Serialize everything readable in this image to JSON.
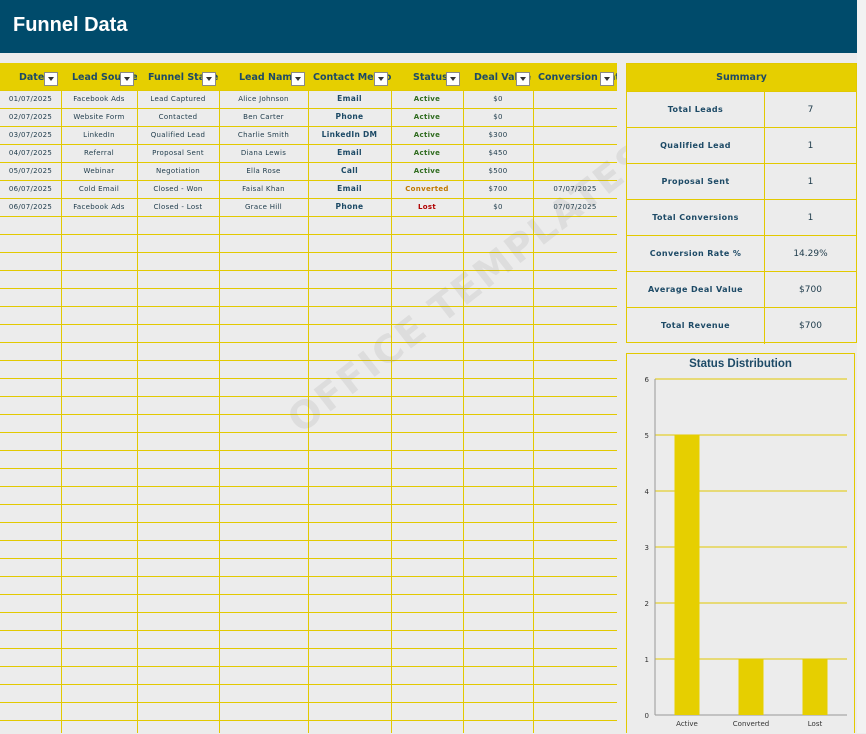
{
  "header": {
    "title": "Funnel Data"
  },
  "table": {
    "columns": [
      "Date",
      "Lead Source",
      "Funnel Stage",
      "Lead Name",
      "Contact Method",
      "Status",
      "Deal Value",
      "Conversion Date"
    ],
    "rows": [
      {
        "date": "01/07/2025",
        "source": "Facebook Ads",
        "stage": "Lead Captured",
        "name": "Alice Johnson",
        "method": "Email",
        "status": "Active",
        "value": "$0",
        "conv": ""
      },
      {
        "date": "02/07/2025",
        "source": "Website Form",
        "stage": "Contacted",
        "name": "Ben Carter",
        "method": "Phone",
        "status": "Active",
        "value": "$0",
        "conv": ""
      },
      {
        "date": "03/07/2025",
        "source": "LinkedIn",
        "stage": "Qualified Lead",
        "name": "Charlie Smith",
        "method": "LinkedIn DM",
        "status": "Active",
        "value": "$300",
        "conv": ""
      },
      {
        "date": "04/07/2025",
        "source": "Referral",
        "stage": "Proposal Sent",
        "name": "Diana Lewis",
        "method": "Email",
        "status": "Active",
        "value": "$450",
        "conv": ""
      },
      {
        "date": "05/07/2025",
        "source": "Webinar",
        "stage": "Negotiation",
        "name": "Ella Rose",
        "method": "Call",
        "status": "Active",
        "value": "$500",
        "conv": ""
      },
      {
        "date": "06/07/2025",
        "source": "Cold Email",
        "stage": "Closed - Won",
        "name": "Faisal Khan",
        "method": "Email",
        "status": "Converted",
        "value": "$700",
        "conv": "07/07/2025"
      },
      {
        "date": "06/07/2025",
        "source": "Facebook Ads",
        "stage": "Closed - Lost",
        "name": "Grace Hill",
        "method": "Phone",
        "status": "Lost",
        "value": "$0",
        "conv": "07/07/2025"
      }
    ]
  },
  "summary": {
    "title": "Summary",
    "items": [
      {
        "label": "Total Leads",
        "value": "7"
      },
      {
        "label": "Qualified Lead",
        "value": "1"
      },
      {
        "label": "Proposal Sent",
        "value": "1"
      },
      {
        "label": "Total Conversions",
        "value": "1"
      },
      {
        "label": "Conversion Rate %",
        "value": "14.29%"
      },
      {
        "label": "Average Deal Value",
        "value": "$700"
      },
      {
        "label": "Total Revenue",
        "value": "$700"
      }
    ]
  },
  "watermark": "OFFICE TEMPLATES",
  "chart_data": {
    "type": "bar",
    "title": "Status Distribution",
    "categories": [
      "Active",
      "Converted",
      "Lost"
    ],
    "values": [
      5,
      1,
      1
    ],
    "ylim": [
      0,
      6
    ],
    "yticks": [
      "0",
      "1",
      "2",
      "3",
      "4",
      "5",
      "6"
    ],
    "grid": true,
    "color": "#e6cf00"
  }
}
